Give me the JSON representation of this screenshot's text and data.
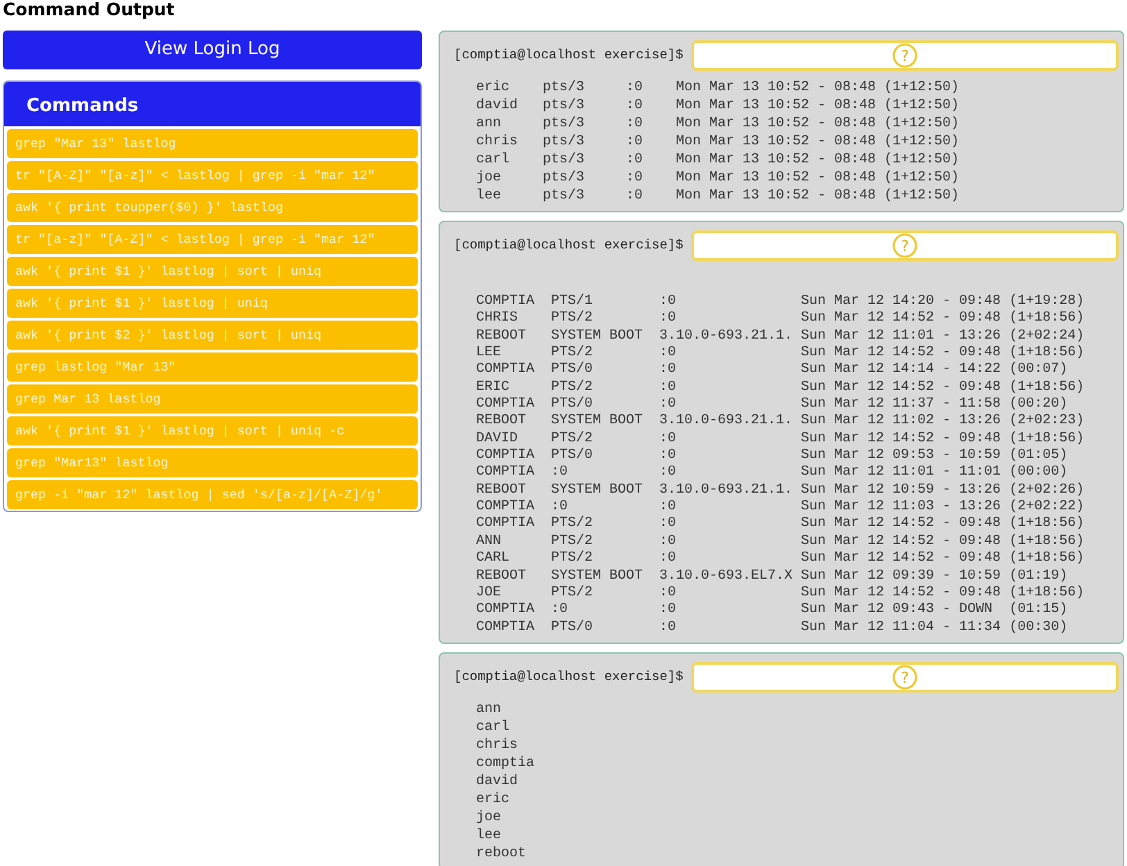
{
  "title": "Command Output",
  "view_button": "View Login Log",
  "commands": {
    "title": "Commands",
    "items": [
      "grep \"Mar 13\" lastlog",
      "tr \"[A-Z]\" \"[a-z]\" < lastlog | grep -i \"mar 12\"",
      "awk '{ print toupper($0) }' lastlog",
      "tr \"[a-z]\" \"[A-Z]\" < lastlog | grep -i \"mar 12\"",
      "awk '{ print $1 }' lastlog | sort | uniq",
      "awk '{ print $1 }' lastlog | uniq",
      "awk '{ print $2 }' lastlog | sort | uniq",
      "grep lastlog \"Mar 13\"",
      "grep Mar 13 lastlog",
      "awk '{ print $1 }' lastlog | sort | uniq -c",
      "grep \"Mar13\" lastlog",
      "grep -i \"mar 12\" lastlog | sed 's/[a-z]/[A-Z]/g'"
    ]
  },
  "panels": [
    {
      "prompt": "[comptia@localhost exercise]$",
      "help": "?",
      "lines": [
        "eric    pts/3     :0    Mon Mar 13 10:52 - 08:48 (1+12:50)",
        "david   pts/3     :0    Mon Mar 13 10:52 - 08:48 (1+12:50)",
        "ann     pts/3     :0    Mon Mar 13 10:52 - 08:48 (1+12:50)",
        "chris   pts/3     :0    Mon Mar 13 10:52 - 08:48 (1+12:50)",
        "carl    pts/3     :0    Mon Mar 13 10:52 - 08:48 (1+12:50)",
        "joe     pts/3     :0    Mon Mar 13 10:52 - 08:48 (1+12:50)",
        "lee     pts/3     :0    Mon Mar 13 10:52 - 08:48 (1+12:50)"
      ]
    },
    {
      "prompt": "[comptia@localhost exercise]$",
      "help": "?",
      "lines": [
        "COMPTIA  PTS/1        :0               Sun Mar 12 14:20 - 09:48 (1+19:28)",
        "CHRIS    PTS/2        :0               Sun Mar 12 14:52 - 09:48 (1+18:56)",
        "REBOOT   SYSTEM BOOT  3.10.0-693.21.1. Sun Mar 12 11:01 - 13:26 (2+02:24)",
        "LEE      PTS/2        :0               Sun Mar 12 14:52 - 09:48 (1+18:56)",
        "COMPTIA  PTS/0        :0               Sun Mar 12 14:14 - 14:22 (00:07)",
        "ERIC     PTS/2        :0               Sun Mar 12 14:52 - 09:48 (1+18:56)",
        "COMPTIA  PTS/0        :0               Sun Mar 12 11:37 - 11:58 (00:20)",
        "REBOOT   SYSTEM BOOT  3.10.0-693.21.1. Sun Mar 12 11:02 - 13:26 (2+02:23)",
        "DAVID    PTS/2        :0               Sun Mar 12 14:52 - 09:48 (1+18:56)",
        "COMPTIA  PTS/0        :0               Sun Mar 12 09:53 - 10:59 (01:05)",
        "COMPTIA  :0           :0               Sun Mar 12 11:01 - 11:01 (00:00)",
        "REBOOT   SYSTEM BOOT  3.10.0-693.21.1. Sun Mar 12 10:59 - 13:26 (2+02:26)",
        "COMPTIA  :0           :0               Sun Mar 12 11:03 - 13:26 (2+02:22)",
        "COMPTIA  PTS/2        :0               Sun Mar 12 14:52 - 09:48 (1+18:56)",
        "ANN      PTS/2        :0               Sun Mar 12 14:52 - 09:48 (1+18:56)",
        "CARL     PTS/2        :0               Sun Mar 12 14:52 - 09:48 (1+18:56)",
        "REBOOT   SYSTEM BOOT  3.10.0-693.EL7.X Sun Mar 12 09:39 - 10:59 (01:19)",
        "JOE      PTS/2        :0               Sun Mar 12 14:52 - 09:48 (1+18:56)",
        "COMPTIA  :0           :0               Sun Mar 12 09:43 - DOWN  (01:15)",
        "COMPTIA  PTS/0        :0               Sun Mar 12 11:04 - 11:34 (00:30)"
      ]
    },
    {
      "prompt": "[comptia@localhost exercise]$",
      "help": "?",
      "lines": [
        "ann",
        "carl",
        "chris",
        "comptia",
        "david",
        "eric",
        "joe",
        "lee",
        "reboot"
      ]
    }
  ]
}
